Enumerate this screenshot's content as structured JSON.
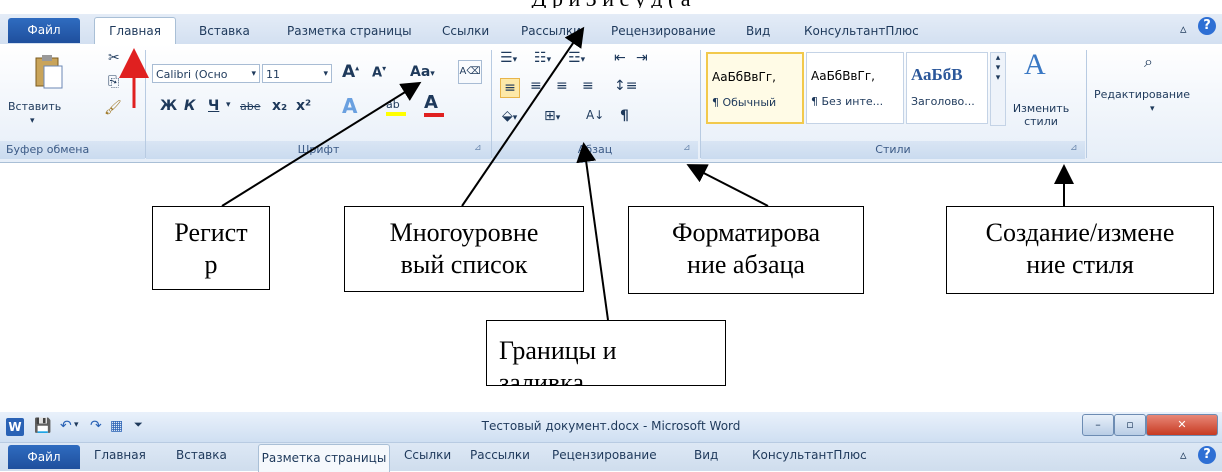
{
  "top_caption": "Д                        р                  и   З              и             с            у         д   (          а",
  "ribbon1": {
    "file_tab": "Файл",
    "tabs": [
      "Главная",
      "Вставка",
      "Разметка страницы",
      "Ссылки",
      "Рассылки",
      "Рецензирование",
      "Вид",
      "КонсультантПлюс"
    ],
    "active_tab": "Главная",
    "clipboard": {
      "paste_label": "Вставить",
      "group_label": "Буфер обмена"
    },
    "font": {
      "font_name": "Calibri (Осно",
      "font_size": "11",
      "group_label": "Шрифт",
      "bold": "Ж",
      "italic": "К",
      "underline": "Ч",
      "strike": "abe",
      "sub": "x₂",
      "sup": "x²",
      "case": "Aa"
    },
    "paragraph": {
      "group_label": "Абзац",
      "pilcrow": "¶"
    },
    "styles": {
      "group_label": "Стили",
      "items": [
        {
          "sample": "АаБбВвГг,",
          "name": "¶ Обычный"
        },
        {
          "sample": "АаБбВвГг,",
          "name": "¶ Без инте..."
        },
        {
          "sample": "АаБбВ",
          "name": "Заголово..."
        }
      ],
      "change_styles": "Изменить стили"
    },
    "editing": {
      "label": "Редактирование"
    }
  },
  "callouts": {
    "register": "Регист\nр",
    "multilevel": "Многоуровне\nвый список",
    "paragraph_format": "Форматирова\nние абзаца",
    "style_create": "Создание/измене\nние стиля",
    "borders": "Границы и\nзаливка"
  },
  "ribbon2": {
    "title": "Тестовый документ.docx - Microsoft Word",
    "file_tab": "Файл",
    "tabs": [
      "Главная",
      "Вставка",
      "Разметка страницы",
      "Ссылки",
      "Рассылки",
      "Рецензирование",
      "Вид",
      "КонсультантПлюс"
    ],
    "active_tab": "Разметка страницы",
    "app_icon": "W"
  },
  "colors": {
    "file_tab": "#2a62b5",
    "arrow_red": "#e02020",
    "ribbon_blue": "#d3e0f1",
    "help_blue": "#2e6fd4"
  },
  "icons": [
    "cut-icon",
    "copy-icon",
    "format-painter-icon",
    "paste-icon",
    "grow-font-icon",
    "shrink-font-icon",
    "clear-format-icon",
    "bullets-icon",
    "numbering-icon",
    "multilevel-list-icon",
    "indent-icon",
    "outdent-icon",
    "align-left-icon",
    "align-center-icon",
    "align-right-icon",
    "justify-icon",
    "line-spacing-icon",
    "shading-icon",
    "borders-icon",
    "sort-icon",
    "pilcrow-icon",
    "change-styles-icon",
    "find-icon",
    "help-icon",
    "minimize-ribbon-icon",
    "save-icon",
    "undo-icon",
    "redo-icon",
    "word-icon",
    "minimize-icon",
    "maximize-icon",
    "close-icon"
  ]
}
